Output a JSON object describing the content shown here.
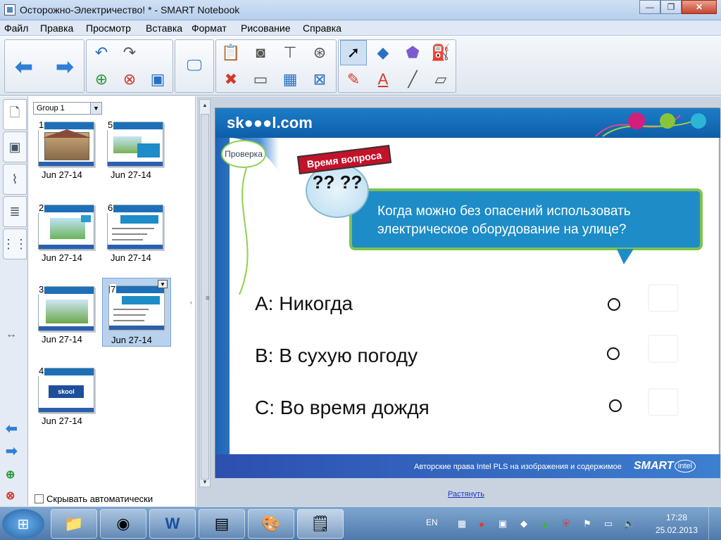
{
  "window": {
    "title": "Осторожно-Электричество! * - SMART Notebook",
    "minimize": "—",
    "maximize": "❐",
    "close": "✕"
  },
  "menu": [
    "Файл",
    "Правка",
    "Просмотр",
    "Вставка",
    "Формат",
    "Рисование",
    "Справка"
  ],
  "sorter": {
    "group": "Group 1",
    "pages": [
      {
        "num": "1",
        "date": "Jun  27-14"
      },
      {
        "num": "2",
        "date": "Jun  27-14"
      },
      {
        "num": "3",
        "date": "Jun  27-14"
      },
      {
        "num": "4",
        "date": "Jun  27-14"
      },
      {
        "num": "5",
        "date": "Jun  27-14"
      },
      {
        "num": "6",
        "date": "Jun  27-14"
      },
      {
        "num": "7",
        "date": "Jun  27-14"
      }
    ],
    "autohide_label": "Скрывать автоматически"
  },
  "slide": {
    "logo": "sk●●●l.com",
    "check_label": "Проверка",
    "time_badge": "Время вопроса",
    "question_marks": "?? ??",
    "question": "Когда можно без опасений использовать электрическое оборудование на улице?",
    "answers": [
      {
        "text": "A: Никогда"
      },
      {
        "text": "B: В сухую погоду"
      },
      {
        "text": "C: Во время дождя"
      }
    ],
    "footer_copy": "Авторские права Intel PLS на изображения и содержимое",
    "footer_smart": "SMART",
    "footer_intel": "intel"
  },
  "workspace": {
    "stretch_link": "Растянуть"
  },
  "taskbar": {
    "lang": "EN",
    "time": "17:28",
    "date": "25.02.2013"
  },
  "colors": {
    "slide_blue": "#1d8cc7",
    "slide_green": "#7ec250",
    "badge_red": "#c4122b"
  }
}
